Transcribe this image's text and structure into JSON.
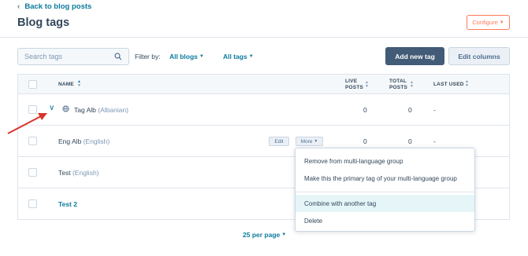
{
  "header": {
    "back_label": "Back to blog posts",
    "title": "Blog tags",
    "configure_label": "Configure"
  },
  "toolbar": {
    "search_placeholder": "Search tags",
    "filter_label": "Filter by:",
    "blogs_filter": "All blogs",
    "tags_filter": "All tags",
    "add_tag_label": "Add new tag",
    "edit_columns_label": "Edit columns"
  },
  "table": {
    "columns": {
      "name": "NAME",
      "live_posts_1": "LIVE",
      "live_posts_2": "POSTS",
      "total_posts_1": "TOTAL",
      "total_posts_2": "POSTS",
      "last_used": "LAST USED"
    },
    "rows": [
      {
        "name": "Tag Alb",
        "lang": "(Albanian)",
        "live": "0",
        "total": "0",
        "last_used": "-"
      },
      {
        "name": "Eng Alb",
        "lang": "(English)",
        "live": "0",
        "total": "0",
        "last_used": "-",
        "edit_label": "Edit",
        "more_label": "More"
      },
      {
        "name": "Test",
        "lang": "(English)"
      },
      {
        "name": "Test 2"
      }
    ]
  },
  "more_menu": {
    "items": [
      "Remove from multi-language group",
      "Make this the primary tag of your multi-language group",
      "Combine with another tag",
      "Delete"
    ]
  },
  "pagination": {
    "per_page_label": "25 per page"
  },
  "colors": {
    "accent": "#0b7a9c",
    "primary_button": "#425b76",
    "configure": "#ff7a59",
    "annotation_arrow": "#d9342b"
  }
}
